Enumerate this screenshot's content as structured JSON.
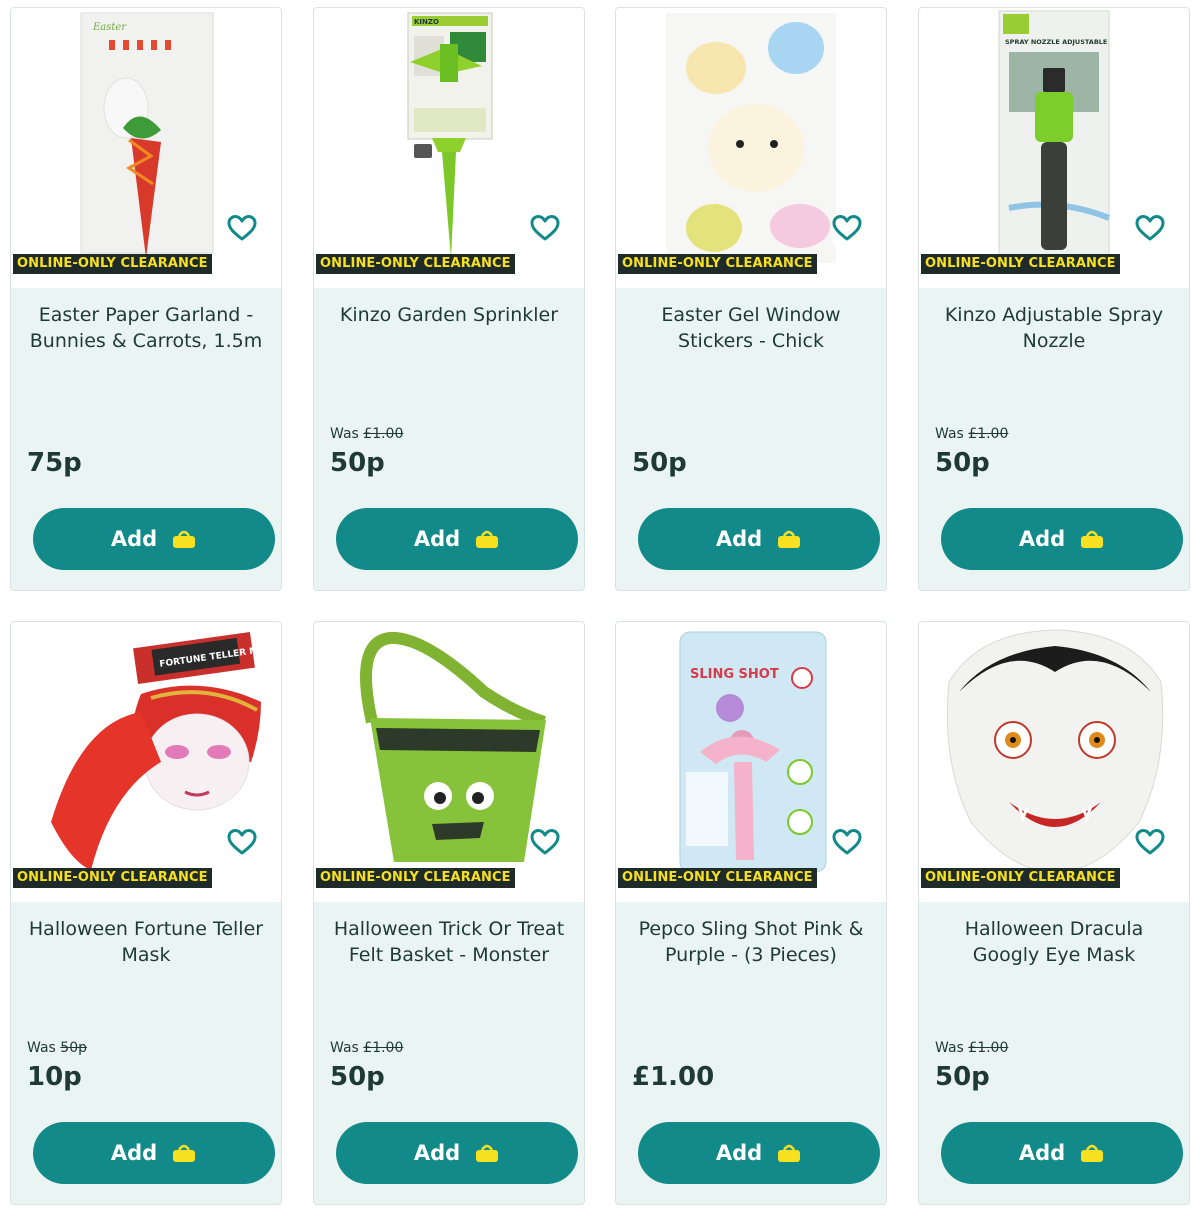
{
  "badge_text": "ONLINE-ONLY CLEARANCE",
  "add_label": "Add",
  "was_label": "Was",
  "colors": {
    "accent": "#128a8a",
    "badge_bg": "#1e2b28",
    "badge_text": "#f6e020",
    "card_bg": "#eaf4f3",
    "basket": "#f6e020"
  },
  "icons": {
    "favourite": "heart-outline-icon",
    "basket": "shopping-basket-icon"
  },
  "products": [
    {
      "title": "Easter Paper Garland - Bunnies & Carrots, 1.5m",
      "was": "",
      "price": "75p",
      "image_text": "Easter"
    },
    {
      "title": "Kinzo Garden Sprinkler",
      "was": "£1.00",
      "price": "50p",
      "image_text": "KINZO"
    },
    {
      "title": "Easter Gel Window Stickers - Chick",
      "was": "",
      "price": "50p",
      "image_text": ""
    },
    {
      "title": "Kinzo Adjustable Spray Nozzle",
      "was": "£1.00",
      "price": "50p",
      "image_text": "SPRAY NOZZLE ADJUSTABLE"
    },
    {
      "title": "Halloween Fortune Teller Mask",
      "was": "50p",
      "price": "10p",
      "image_text": "FORTUNE TELLER MASK"
    },
    {
      "title": "Halloween Trick Or Treat Felt Basket - Monster",
      "was": "£1.00",
      "price": "50p",
      "image_text": ""
    },
    {
      "title": "Pepco Sling Shot Pink & Purple - (3 Pieces)",
      "was": "",
      "price": "£1.00",
      "image_text": "SLING SHOT"
    },
    {
      "title": "Halloween Dracula Googly Eye Mask",
      "was": "£1.00",
      "price": "50p",
      "image_text": ""
    }
  ]
}
